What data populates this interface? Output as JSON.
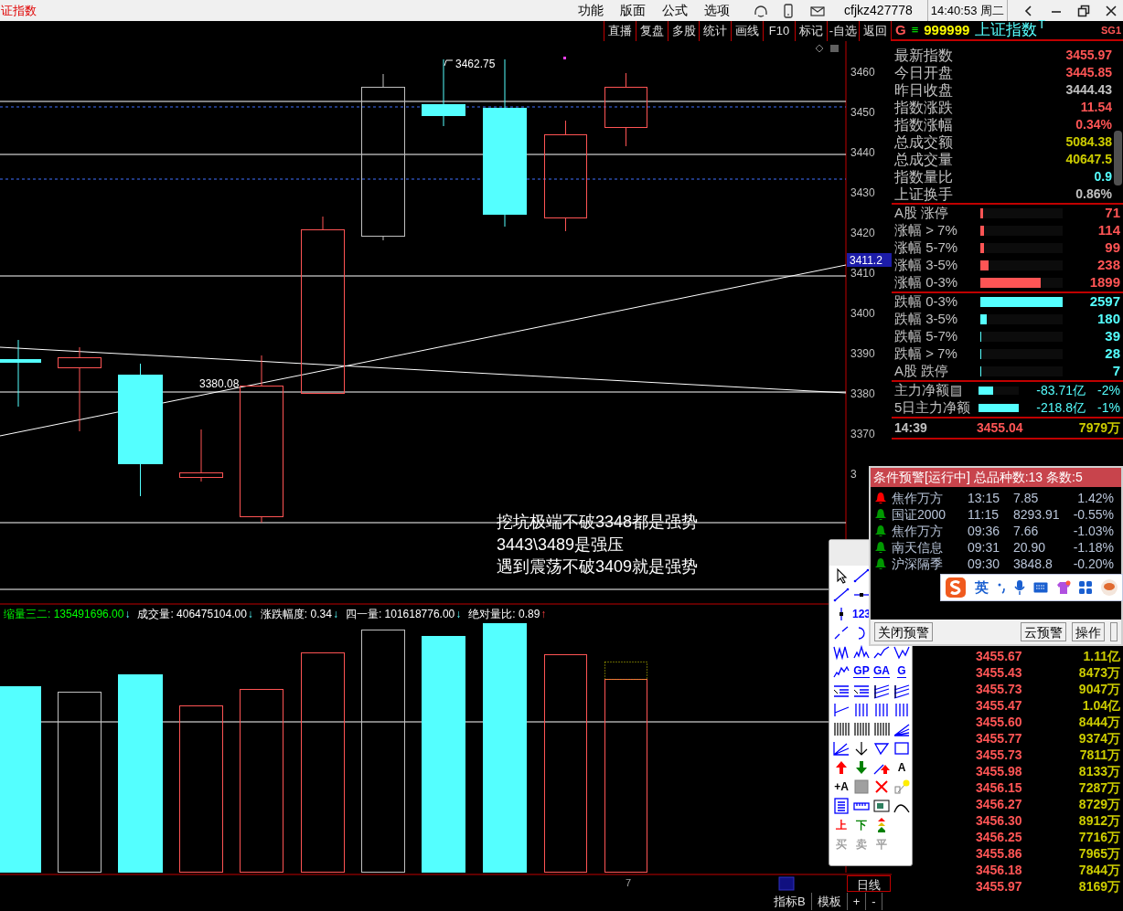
{
  "title_bar": {
    "app_title": "证指数",
    "menu": [
      "功能",
      "版面",
      "公式",
      "选项"
    ],
    "user": "cfjkz427778",
    "clock": "14:40:53 周二"
  },
  "toolbar": [
    "直播",
    "复盘",
    "多股",
    "统计",
    "画线",
    "F10",
    "标记",
    "-自选",
    "返回"
  ],
  "chart": {
    "price_axis": [
      "3460",
      "3450",
      "3440",
      "3430",
      "3420",
      "3410",
      "3400",
      "3390",
      "3380",
      "3370",
      "3"
    ],
    "price_tag": "3411.2",
    "high_label": "3462.75",
    "low_label": "3380.08",
    "notes": [
      "挖坑极端不破3348都是强势",
      "3443\\3489是强压",
      "遇到震荡不破3409就是强势"
    ]
  },
  "volume": {
    "indicators": [
      {
        "label": "缩量三二:",
        "value": "135491696.00",
        "color": "#00ff00",
        "arrow": "↓",
        "kind": "down"
      },
      {
        "label": "成交量:",
        "value": "406475104.00",
        "color": "#ffffff",
        "arrow": "↓",
        "kind": "down"
      },
      {
        "label": "涨跌幅度:",
        "value": "0.34",
        "color": "#ffffff",
        "arrow": "↓",
        "kind": "down"
      },
      {
        "label": "四一量:",
        "value": "101618776.00",
        "color": "#ffffff",
        "arrow": "↓",
        "kind": "down"
      },
      {
        "label": "绝对量比:",
        "value": "0.89",
        "color": "#ffffff",
        "arrow": "↑",
        "kind": "up"
      }
    ]
  },
  "bottom": {
    "period_marker": "7",
    "tabs": [
      "指标B",
      "模板",
      "+",
      "-"
    ],
    "period": "日线"
  },
  "quote_panel": {
    "badge": "G",
    "menu_glyph": "≡",
    "code": "999999",
    "name": "上证指数",
    "superscript": "T",
    "tag": "SG1",
    "stats": [
      {
        "label": "最新指数",
        "value": "3455.97",
        "color": "#ff5555"
      },
      {
        "label": "今日开盘",
        "value": "3445.85",
        "color": "#ff5555"
      },
      {
        "label": "昨日收盘",
        "value": "3444.43",
        "color": "#c0c0c0"
      },
      {
        "label": "指数涨跌",
        "value": "11.54",
        "color": "#ff5555"
      },
      {
        "label": "指数涨幅",
        "value": "0.34%",
        "color": "#ff5555"
      },
      {
        "label": "总成交额",
        "value": "5084.38",
        "color": "#cccc00"
      },
      {
        "label": "总成交量",
        "value": "40647.5",
        "color": "#cccc00"
      },
      {
        "label": "指数量比",
        "value": "0.9",
        "color": "#55ffff"
      },
      {
        "label": "上证换手",
        "value": "0.86%",
        "color": "#c0c0c0"
      }
    ],
    "breadth_up": [
      {
        "label": "A股 涨停",
        "count": "71",
        "level": 0.03
      },
      {
        "label": "涨幅 > 7%",
        "count": "114",
        "level": 0.04
      },
      {
        "label": "涨幅 5-7%",
        "count": "99",
        "level": 0.04
      },
      {
        "label": "涨幅 3-5%",
        "count": "238",
        "level": 0.1
      },
      {
        "label": "涨幅 0-3%",
        "count": "1899",
        "level": 0.73
      }
    ],
    "breadth_down": [
      {
        "label": "跌幅 0-3%",
        "count": "2597",
        "level": 1.0
      },
      {
        "label": "跌幅 3-5%",
        "count": "180",
        "level": 0.08
      },
      {
        "label": "跌幅 5-7%",
        "count": "39",
        "level": 0.01
      },
      {
        "label": "跌幅 > 7%",
        "count": "28",
        "level": 0.01
      },
      {
        "label": "A股 跌停",
        "count": "7",
        "level": 0.01
      }
    ],
    "flows": [
      {
        "label": "主力净额",
        "amount": "-83.71亿",
        "pct": "-2%",
        "level": 0.36
      },
      {
        "label": "5日主力净额",
        "amount": "-218.8亿",
        "pct": "-1%",
        "level": 1.0
      }
    ],
    "last_tick": {
      "time": "14:39",
      "price": "3455.04",
      "volume": "7979万"
    },
    "ticks": [
      {
        "price": "3455.67",
        "volume": "1.11亿"
      },
      {
        "price": "3455.43",
        "volume": "8473万"
      },
      {
        "price": "3455.73",
        "volume": "9047万"
      },
      {
        "price": "3455.47",
        "volume": "1.04亿"
      },
      {
        "price": "3455.60",
        "volume": "8444万"
      },
      {
        "price": "3455.77",
        "volume": "9374万"
      },
      {
        "price": "3455.73",
        "volume": "7811万"
      },
      {
        "price": "3455.98",
        "volume": "8133万"
      },
      {
        "price": "3456.15",
        "volume": "7287万"
      },
      {
        "price": "3456.27",
        "volume": "8729万"
      },
      {
        "price": "3456.30",
        "volume": "8912万"
      },
      {
        "price": "3456.25",
        "volume": "7716万"
      },
      {
        "price": "3455.86",
        "volume": "7965万"
      },
      {
        "price": "3456.18",
        "volume": "7844万"
      },
      {
        "price": "3455.97",
        "volume": "8169万"
      }
    ]
  },
  "alert_window": {
    "title": "条件预警[运行中] 总品种数:13 条数:5",
    "rows": [
      {
        "name": "焦作万方",
        "time": "13:15",
        "price": "7.85",
        "change": "1.42%",
        "color": "#ff0000"
      },
      {
        "name": "国证2000",
        "time": "11:15",
        "price": "8293.91",
        "change": "-0.55%",
        "color": "#009900"
      },
      {
        "name": "焦作万方",
        "time": "09:36",
        "price": "7.66",
        "change": "-1.03%",
        "color": "#009900"
      },
      {
        "name": "南天信息",
        "time": "09:31",
        "price": "20.90",
        "change": "-1.18%",
        "color": "#009900"
      },
      {
        "name": "沪深隔季",
        "time": "09:30",
        "price": "3848.8",
        "change": "-0.20%",
        "color": "#009900"
      }
    ],
    "buttons": [
      "关闭预警",
      "云预警",
      "操作"
    ]
  },
  "ime_toolbar": {
    "mode": "英"
  },
  "drawing_tools": {
    "labels": [
      "123",
      "GP",
      "GA",
      "G",
      "A",
      "+A",
      "上",
      "下",
      "买",
      "卖",
      "平"
    ]
  }
}
